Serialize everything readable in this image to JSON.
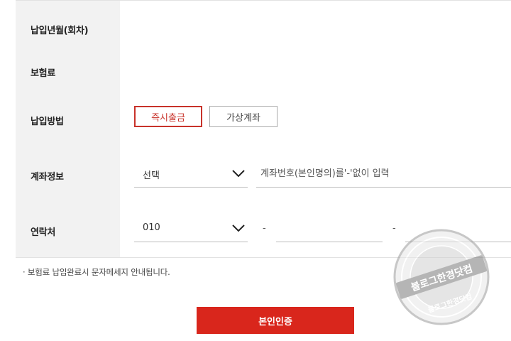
{
  "form": {
    "labels": {
      "payment_month": "납입년월(회차)",
      "premium": "보험료",
      "payment_method": "납입방법",
      "account_info": "계좌정보",
      "contact": "연락처"
    },
    "payment_methods": [
      {
        "label": "즉시출금",
        "selected": true
      },
      {
        "label": "가상계좌",
        "selected": false
      }
    ],
    "account": {
      "bank_select_value": "선택",
      "account_input_placeholder": "계좌번호(본인명의)를'-'없이 입력"
    },
    "contact": {
      "prefix_select_value": "010",
      "separator": "-"
    }
  },
  "notice": "· 보험료 납입완료시 문자메세지 안내됩니다.",
  "submit_label": "본인인증",
  "watermark": {
    "main_text": "블로그한경닷컴",
    "sub_text": "블로그한경닷컴"
  },
  "colors": {
    "accent": "#d9261c",
    "active_border": "#c8322a",
    "label_bg": "#f2f2f2"
  }
}
